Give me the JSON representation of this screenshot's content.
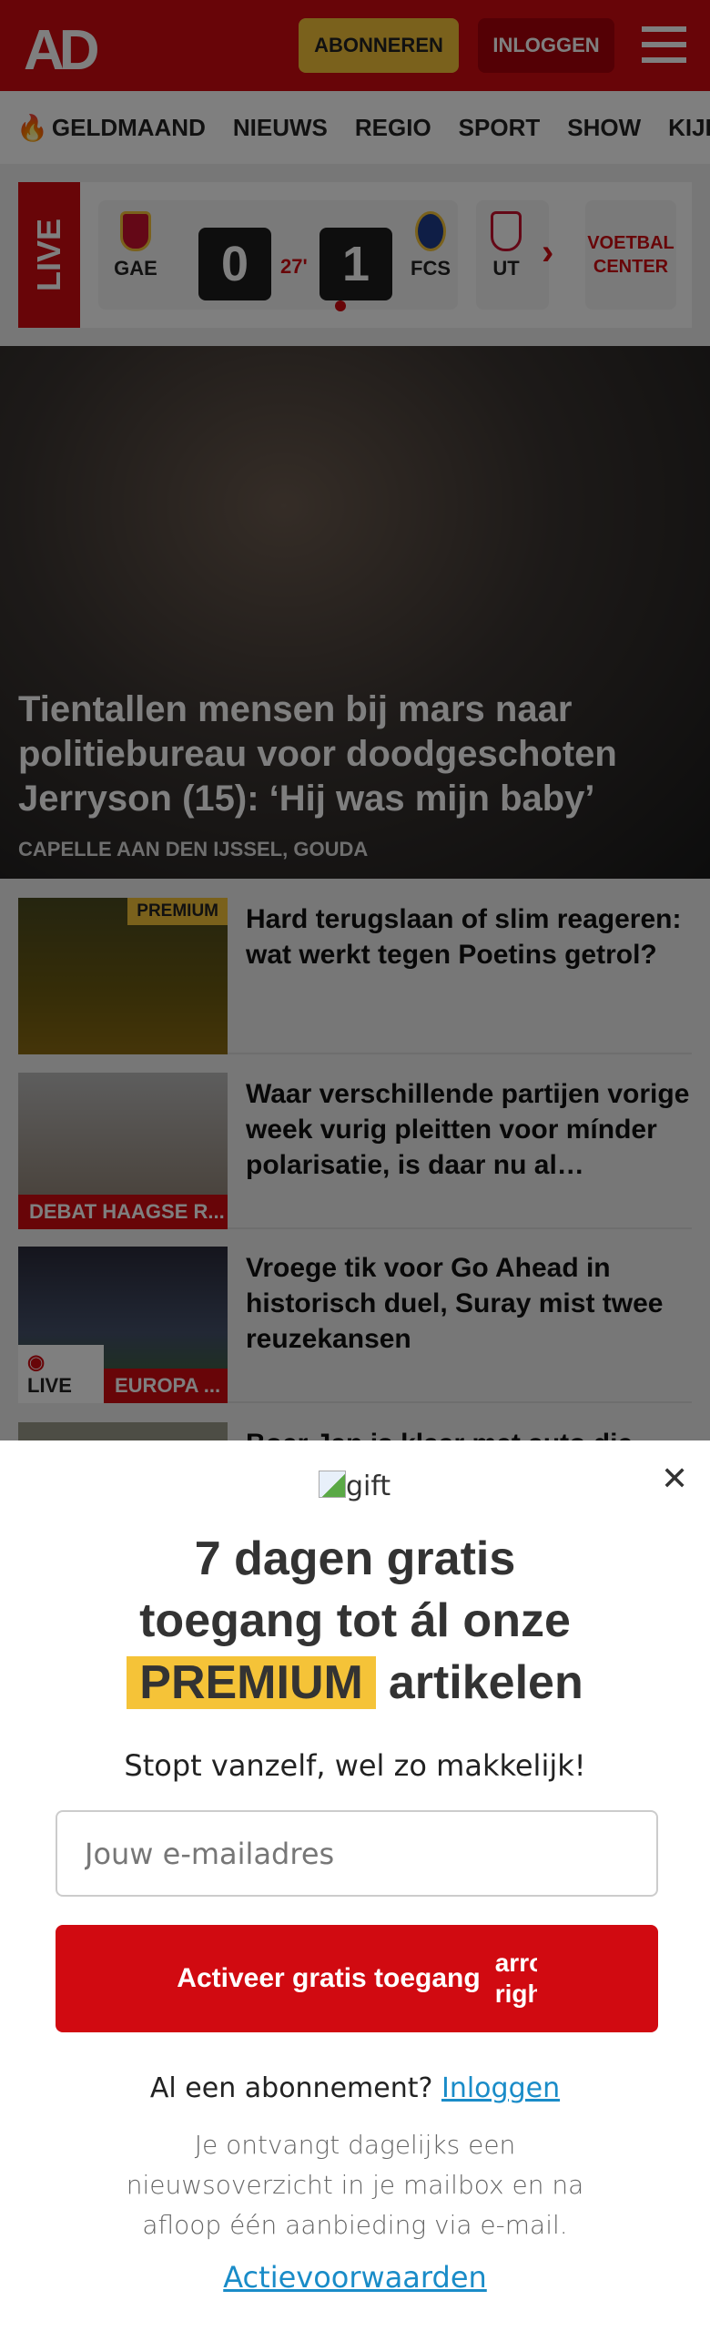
{
  "header": {
    "logo": "AD",
    "subscribe": "ABONNEREN",
    "login": "INLOGGEN"
  },
  "nav": [
    "GELDMAAND",
    "NIEUWS",
    "REGIO",
    "SPORT",
    "SHOW",
    "KIJK"
  ],
  "live": {
    "label": "LIVE",
    "home": "GAE",
    "away": "FCS",
    "home_score": "0",
    "away_score": "1",
    "minute": "27'",
    "next_team": "UT",
    "center": "VOETBAL CENTER"
  },
  "hero": {
    "title": "Tientallen mensen bij mars naar politiebureau voor doodgeschoten Jerryson (15): ‘Hij was mijn baby’",
    "caption": "CAPELLE AAN DEN IJSSEL, GOUDA"
  },
  "articles": [
    {
      "title": "Hard terugslaan of slim reageren: wat werkt tegen Poetins getrol?",
      "tag": "PREMIUM"
    },
    {
      "title": "Waar verschillende partijen vorige week vurig pleitten voor mínder polarisatie, is daar nu al…",
      "tag": "DEBAT HAAGSE R..."
    },
    {
      "title": "Vroege tik voor Go Ahead in historisch duel, Suray mist twee reuzekansen",
      "tag": "EUROPA ...",
      "live": "LIVE"
    },
    {
      "title": "Boer Jan is klaar met auto die"
    }
  ],
  "modal": {
    "gift_alt": "gift",
    "line1": "7 dagen gratis",
    "line2": "toegang tot ál onze",
    "premium": "PREMIUM",
    "line3": "artikelen",
    "subtitle": "Stopt vanzelf, wel zo makkelijk!",
    "email_placeholder": "Jouw e-mailadres",
    "cta": "Activeer gratis toegang",
    "cta_icon_alt": "arrow right",
    "already": "Al een abonnement?",
    "login_link": "Inloggen",
    "info": "Je ontvangt dagelijks een nieuwsoverzicht in je mailbox en na afloop één aanbieding via e-mail.",
    "terms": "Actievoorwaarden"
  },
  "colors": {
    "brand": "#d10a11",
    "premium": "#f5c338",
    "link": "#1a8cc8"
  }
}
